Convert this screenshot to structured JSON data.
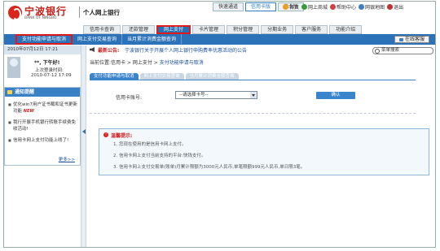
{
  "header": {
    "bank_name": "宁波银行",
    "bank_name_en": "BANK OF NINGBO",
    "site_title": "个人网上银行",
    "quick_tabs": [
      "快速通道",
      "信用卡版",
      "专业版"
    ],
    "top_links": [
      "首页",
      "网上商城",
      "帮助中心",
      "网银地图",
      "退出"
    ]
  },
  "main_nav": [
    "信用卡查询",
    "还款管理",
    "网上支付",
    "卡片管理",
    "积分管理",
    "分期业务",
    "客户服务",
    "功能介绍"
  ],
  "sub_nav": {
    "items": [
      "支付功能申请与取消",
      "网上支付交易查询",
      "当月累计消费金额查询"
    ],
    "customer_service": "在线客服"
  },
  "left": {
    "date_time": "2010年07月12日  17:21",
    "greeting": "**, 下午好!",
    "last_login_label": "上次登录时间:",
    "last_login_time": "2010-07-12 17:09",
    "notice_title": "通知提醒",
    "notices": [
      {
        "text": "优化win7用户证书载和证书更新功能",
        "tag": "NEW"
      },
      {
        "text": "我行开展手机银行转账手续费免收活动!",
        "tag": ""
      },
      {
        "text": "信用卡网上支付功能上线了!",
        "tag": ""
      }
    ],
    "more": "更多>>"
  },
  "content": {
    "announcement_label": "最新公告:",
    "announcement_text": "宁波银行关于开展个人网上银行申购费率优惠活动的公告",
    "search_placeholder": "菜单搜索",
    "breadcrumb_prefix": "当前位置:信用卡 > 网上支付 > ",
    "breadcrumb_current": "支付功能申请与取消",
    "tabs": [
      "支付功能申请与取消",
      "网上支付交易查询",
      "当月累计消费金额查询"
    ],
    "card_label": "信用卡账号:",
    "card_select": "--请选择卡号--",
    "confirm": "确认",
    "tips_title": "温馨提示:",
    "tips": [
      "1. 您现在使用的是信用卡网上支付。",
      "2. 信用卡网上支付当前支持的平台:快钱支付。",
      "3. 信用卡网上支付交易单(账单)月累计限额为3000元人民币,单笔限额999元人民币,单日限3笔。"
    ]
  },
  "colors": {
    "brand_red": "#c41e16",
    "nav_blue": "#2c72b8",
    "highlight_red": "#e01a1a"
  }
}
